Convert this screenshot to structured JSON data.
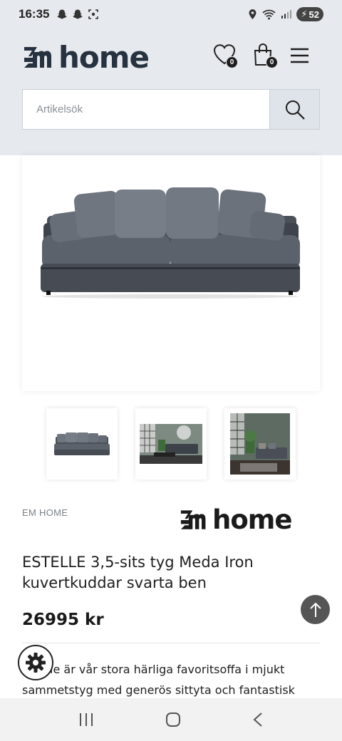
{
  "status_bar": {
    "time": "16:35",
    "battery": "52"
  },
  "header": {
    "logo_text": "home",
    "wishlist_count": "0",
    "cart_count": "0"
  },
  "search": {
    "placeholder": "Artikelsök"
  },
  "product": {
    "brand": "EM HOME",
    "brand_logo_text": "home",
    "title": "ESTELLE 3,5-sits tyg Meda Iron kuvertkuddar svarta ben",
    "price": "26995 kr",
    "description": "Estelle är vår stora härliga favoritsoffa i mjukt sammetstyg med generös sittyta och fantastisk"
  },
  "icons": {
    "status_left": [
      "snapchat-icon",
      "snapchat-icon",
      "screenshot-icon"
    ],
    "status_right": [
      "location-icon",
      "wifi-icon",
      "signal-icon",
      "battery-icon"
    ],
    "header": [
      "heart-icon",
      "bag-icon",
      "menu-icon"
    ],
    "search": "search-icon",
    "floating": [
      "arrow-up-icon",
      "gear-icon"
    ],
    "nav": [
      "recent-apps-icon",
      "home-icon",
      "back-icon"
    ]
  },
  "colors": {
    "header_bg": "#e6e9ed",
    "logo": "#273240",
    "search_button_bg": "#dfe4ea"
  }
}
